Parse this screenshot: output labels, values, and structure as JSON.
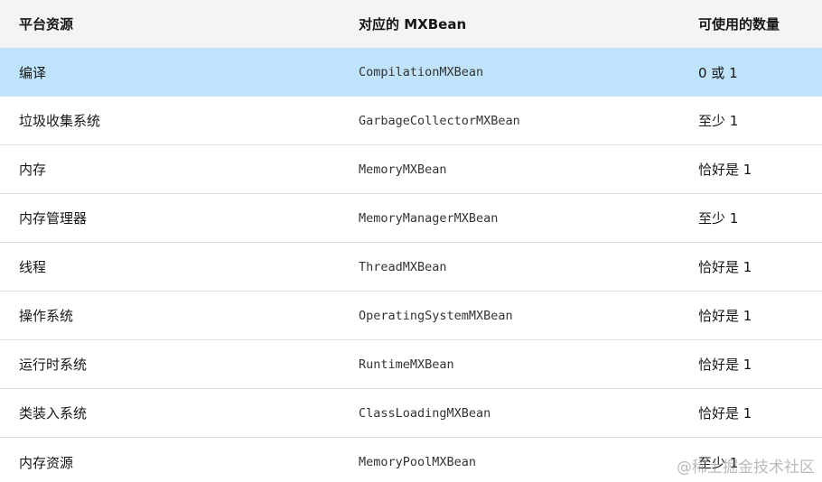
{
  "table": {
    "headers": [
      "平台资源",
      "对应的 MXBean",
      "可使用的数量"
    ],
    "rows": [
      {
        "resource": "编译",
        "mxbean": "CompilationMXBean",
        "count": "0 或 1"
      },
      {
        "resource": "垃圾收集系统",
        "mxbean": "GarbageCollectorMXBean",
        "count": "至少 1"
      },
      {
        "resource": "内存",
        "mxbean": "MemoryMXBean",
        "count": "恰好是 1"
      },
      {
        "resource": "内存管理器",
        "mxbean": "MemoryManagerMXBean",
        "count": "至少 1"
      },
      {
        "resource": "线程",
        "mxbean": "ThreadMXBean",
        "count": "恰好是 1"
      },
      {
        "resource": "操作系统",
        "mxbean": "OperatingSystemMXBean",
        "count": "恰好是 1"
      },
      {
        "resource": "运行时系统",
        "mxbean": "RuntimeMXBean",
        "count": "恰好是 1"
      },
      {
        "resource": "类装入系统",
        "mxbean": "ClassLoadingMXBean",
        "count": "恰好是 1"
      },
      {
        "resource": "内存资源",
        "mxbean": "MemoryPoolMXBean",
        "count": "至少 1"
      }
    ]
  },
  "highlight_row": 0,
  "highlight_color": "#bee3fb",
  "header_bg": "#f4f4f4",
  "watermark": "@稀土掘金技术社区"
}
